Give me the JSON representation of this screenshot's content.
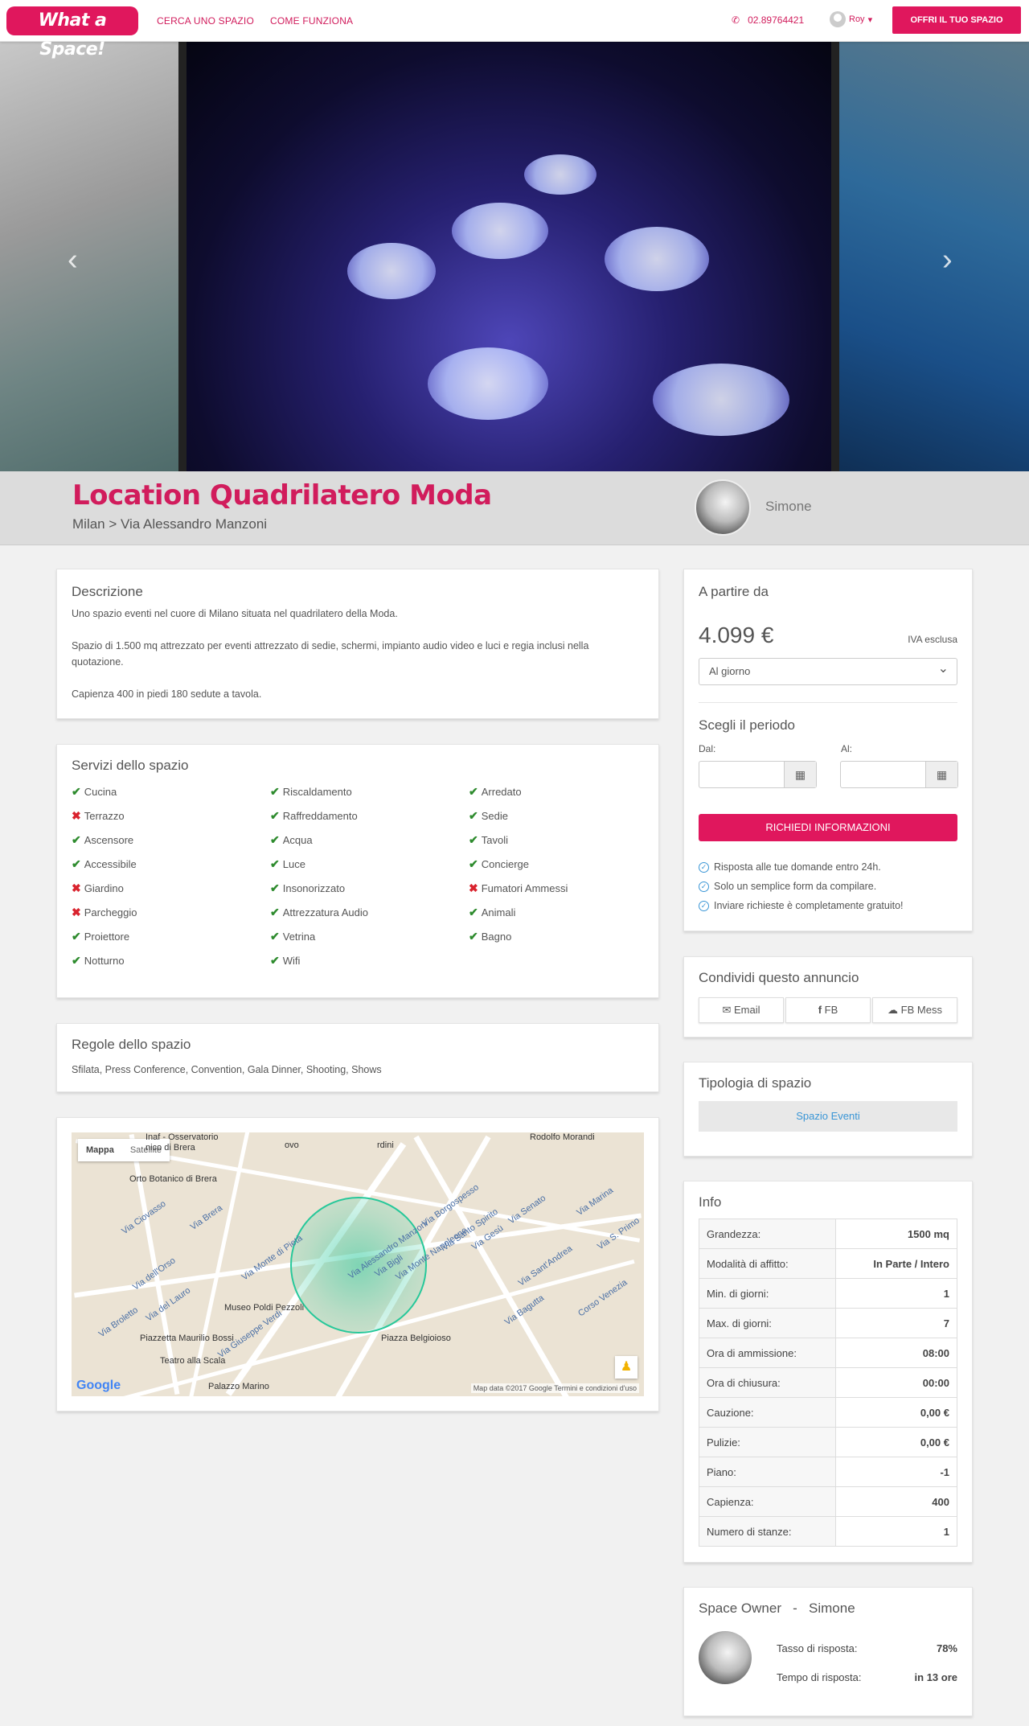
{
  "nav": {
    "logo": "What a Space!",
    "links": [
      "CERCA UNO SPAZIO",
      "COME FUNZIONA"
    ],
    "phone": "02.89764421",
    "user": "Roy",
    "cta": "OFFRI IL TUO SPAZIO"
  },
  "hero": {
    "slides": 6,
    "active_slide": 4
  },
  "listing": {
    "title": "Location Quadrilatero Moda",
    "breadcrumb": "Milan > Via Alessandro Manzoni",
    "owner": "Simone"
  },
  "description": {
    "heading": "Descrizione",
    "p1": "Uno spazio eventi nel cuore di Milano situata nel quadrilatero della Moda.",
    "p2": "Spazio di 1.500 mq attrezzato per eventi attrezzato di sedie, schermi, impianto audio video e luci e regia inclusi nella quotazione.",
    "p3": "Capienza 400 in piedi 180 sedute a tavola."
  },
  "services": {
    "heading": "Servizi dello spazio",
    "col1": [
      {
        "name": "Cucina",
        "ok": true
      },
      {
        "name": "Terrazzo",
        "ok": false
      },
      {
        "name": "Ascensore",
        "ok": true
      },
      {
        "name": "Accessibile",
        "ok": true
      },
      {
        "name": "Giardino",
        "ok": false
      },
      {
        "name": "Parcheggio",
        "ok": false
      },
      {
        "name": "Proiettore",
        "ok": true
      },
      {
        "name": "Notturno",
        "ok": true
      }
    ],
    "col2": [
      {
        "name": "Riscaldamento",
        "ok": true
      },
      {
        "name": "Raffreddamento",
        "ok": true
      },
      {
        "name": "Acqua",
        "ok": true
      },
      {
        "name": "Luce",
        "ok": true
      },
      {
        "name": "Insonorizzato",
        "ok": true
      },
      {
        "name": "Attrezzatura Audio",
        "ok": true
      },
      {
        "name": "Vetrina",
        "ok": true
      },
      {
        "name": "Wifi",
        "ok": true
      }
    ],
    "col3": [
      {
        "name": "Arredato",
        "ok": true
      },
      {
        "name": "Sedie",
        "ok": true
      },
      {
        "name": "Tavoli",
        "ok": true
      },
      {
        "name": "Concierge",
        "ok": true
      },
      {
        "name": "Fumatori Ammessi",
        "ok": false
      },
      {
        "name": "Animali",
        "ok": true
      },
      {
        "name": "Bagno",
        "ok": true
      }
    ]
  },
  "rules": {
    "heading": "Regole dello spazio",
    "text": "Sfilata, Press Conference, Convention, Gala Dinner, Shooting, Shows"
  },
  "map": {
    "toggle": [
      "Mappa",
      "Satellite"
    ],
    "labels": [
      "Inaf - Osservatorio",
      "nico di Brera",
      "Orto Botanico di Brera",
      "Via Ciovasso",
      "Via Brera",
      "Via dell'Orso",
      "Via del Lauro",
      "Via Broletto",
      "Via Giuseppe Verdi",
      "Via Monte di Pietà",
      "Via Alessandro Manzoni",
      "Via Monte Napoleone",
      "Via Bigli",
      "Via Borgospesso",
      "Via Santo Spirito",
      "Via Gesù",
      "Via Senato",
      "Via Marina",
      "Via S. Primo",
      "Via Sant'Andrea",
      "Via Bagutta",
      "Corso Venezia",
      "Museo Poldi Pezzoli",
      "Piazzetta Maurilio Bossi",
      "Teatro alla Scala",
      "Piazza Belgioioso",
      "Palazzo Marino",
      "Rodolfo Morandi",
      "rdini",
      "ovo"
    ],
    "google": "Google",
    "attribution": "Map data ©2017 Google    Termini e condizioni d'uso"
  },
  "pricing": {
    "heading": "A partire da",
    "price": "4.099 €",
    "vat": "IVA esclusa",
    "period_select": "Al giorno",
    "period_heading": "Scegli il periodo",
    "from_label": "Dal:",
    "to_label": "Al:",
    "cta": "RICHIEDI INFORMAZIONI",
    "bullets": [
      "Risposta alle tue domande entro 24h.",
      "Solo un semplice form da compilare.",
      "Inviare richieste è completamente gratuito!"
    ]
  },
  "share": {
    "heading": "Condividi questo annuncio",
    "buttons": [
      "Email",
      "FB",
      "FB Mess"
    ]
  },
  "type": {
    "heading": "Tipologia di spazio",
    "value": "Spazio Eventi"
  },
  "info": {
    "heading": "Info",
    "rows": [
      [
        "Grandezza:",
        "1500 mq"
      ],
      [
        "Modalità di affitto:",
        "In Parte / Intero"
      ],
      [
        "Min. di giorni:",
        "1"
      ],
      [
        "Max. di giorni:",
        "7"
      ],
      [
        "Ora di ammissione:",
        "08:00"
      ],
      [
        "Ora di chiusura:",
        "00:00"
      ],
      [
        "Cauzione:",
        "0,00 €"
      ],
      [
        "Pulizie:",
        "0,00 €"
      ],
      [
        "Piano:",
        "-1"
      ],
      [
        "Capienza:",
        "400"
      ],
      [
        "Numero di stanze:",
        "1"
      ]
    ]
  },
  "owner_card": {
    "heading": "Space Owner",
    "sep": "-",
    "name": "Simone",
    "rate_label": "Tasso di risposta:",
    "rate": "78%",
    "time_label": "Tempo di risposta:",
    "time": "in 13 ore"
  },
  "colors": {
    "brand": "#e0175d",
    "accent": "#3a96d6"
  }
}
